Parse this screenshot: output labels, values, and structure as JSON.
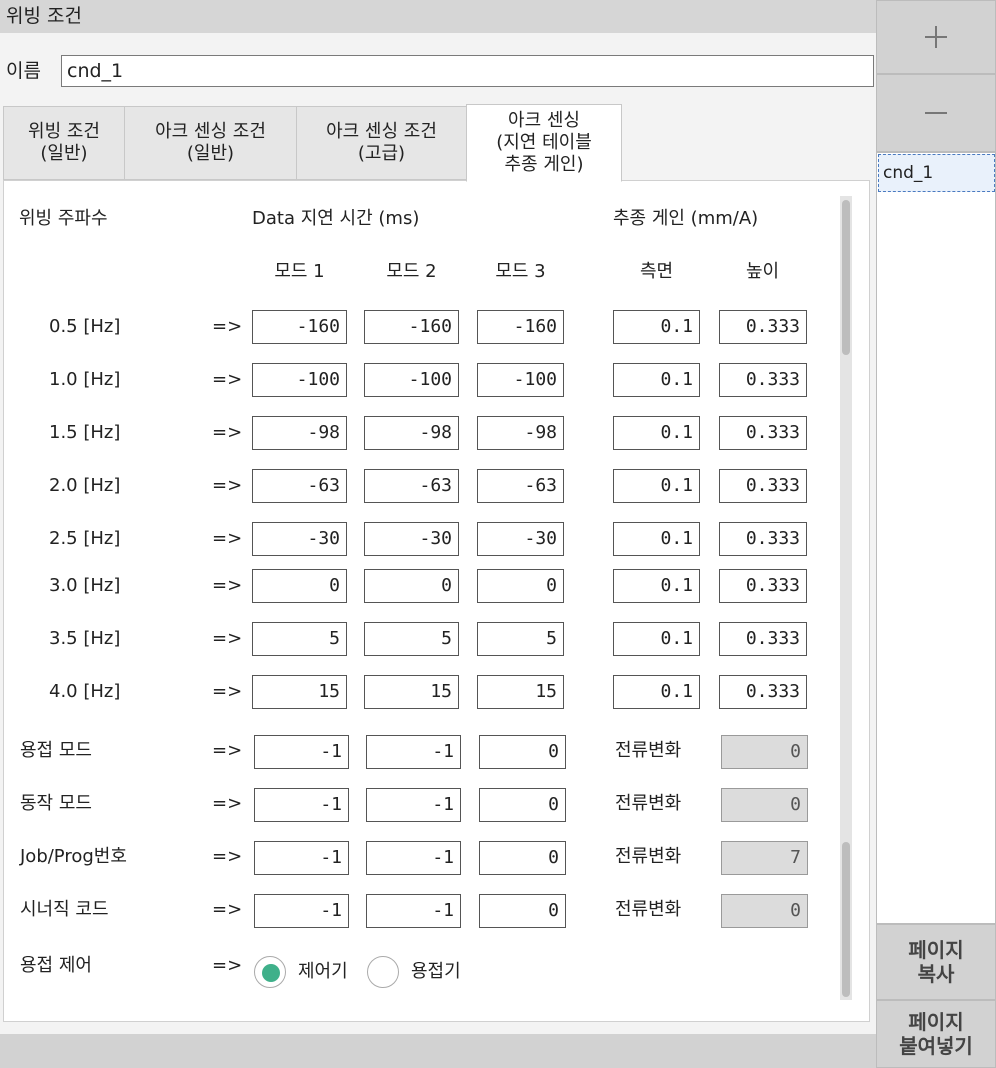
{
  "window_title": "위빙 조건",
  "name_label": "이름",
  "name_value": "cnd_1",
  "tabs": [
    {
      "l1": "위빙 조건",
      "l2": "(일반)",
      "l3": ""
    },
    {
      "l1": "아크 센싱 조건",
      "l2": "(일반)",
      "l3": ""
    },
    {
      "l1": "아크 센싱 조건",
      "l2": "(고급)",
      "l3": ""
    },
    {
      "l1": "아크 센싱",
      "l2": "(지연 테이블",
      "l3": "추종 게인)"
    }
  ],
  "headers": {
    "freq": "위빙 주파수",
    "delay": "Data 지연 시간 (ms)",
    "gain": "추종 게인 (mm/A)",
    "mode1": "모드 1",
    "mode2": "모드 2",
    "mode3": "모드 3",
    "side": "측면",
    "height": "높이"
  },
  "arrow": "=>",
  "freq_rows": [
    {
      "label": "0.5 [Hz]",
      "m1": "-160",
      "m2": "-160",
      "m3": "-160",
      "side": "0.1",
      "height": "0.333"
    },
    {
      "label": "1.0 [Hz]",
      "m1": "-100",
      "m2": "-100",
      "m3": "-100",
      "side": "0.1",
      "height": "0.333"
    },
    {
      "label": "1.5 [Hz]",
      "m1": "-98",
      "m2": "-98",
      "m3": "-98",
      "side": "0.1",
      "height": "0.333"
    },
    {
      "label": "2.0 [Hz]",
      "m1": "-63",
      "m2": "-63",
      "m3": "-63",
      "side": "0.1",
      "height": "0.333"
    },
    {
      "label": "2.5 [Hz]",
      "m1": "-30",
      "m2": "-30",
      "m3": "-30",
      "side": "0.1",
      "height": "0.333"
    },
    {
      "label": "3.0 [Hz]",
      "m1": "0",
      "m2": "0",
      "m3": "0",
      "side": "0.1",
      "height": "0.333"
    },
    {
      "label": "3.5 [Hz]",
      "m1": "5",
      "m2": "5",
      "m3": "5",
      "side": "0.1",
      "height": "0.333"
    },
    {
      "label": "4.0 [Hz]",
      "m1": "15",
      "m2": "15",
      "m3": "15",
      "side": "0.1",
      "height": "0.333"
    }
  ],
  "param_rows": [
    {
      "label": "용접 모드",
      "m1": "-1",
      "m2": "-1",
      "m3": "0",
      "cur_label": "전류변화",
      "cur": "0"
    },
    {
      "label": "동작 모드",
      "m1": "-1",
      "m2": "-1",
      "m3": "0",
      "cur_label": "전류변화",
      "cur": "0"
    },
    {
      "label": "Job/Prog번호",
      "m1": "-1",
      "m2": "-1",
      "m3": "0",
      "cur_label": "전류변화",
      "cur": "7"
    },
    {
      "label": "시너직 코드",
      "m1": "-1",
      "m2": "-1",
      "m3": "0",
      "cur_label": "전류변화",
      "cur": "0"
    }
  ],
  "control": {
    "label": "용접 제어",
    "opt1": "제어기",
    "opt2": "용접기",
    "selected": "opt1"
  },
  "side": {
    "add_icon": "plus-icon",
    "remove_icon": "minus-icon",
    "items": [
      "cnd_1"
    ],
    "copy_l1": "페이지",
    "copy_l2": "복사",
    "paste_l1": "페이지",
    "paste_l2": "붙여넣기"
  },
  "colors": {
    "radio_selected": "#3fb08a",
    "selection_border": "#4a7ac0"
  }
}
